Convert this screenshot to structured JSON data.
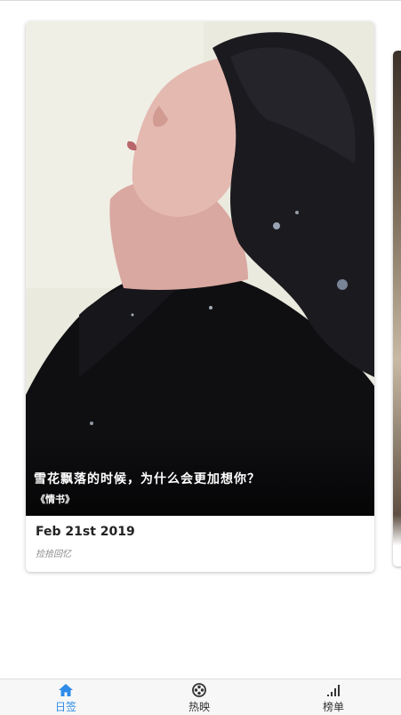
{
  "card": {
    "quote": "雪花飘落的时候，为什么会更加想你？",
    "film": "《情书》",
    "date": "Feb 21st 2019",
    "subtitle": "捡拾回忆"
  },
  "tabbar": {
    "tabs": [
      {
        "label": "日签",
        "icon": "home-icon",
        "active": true
      },
      {
        "label": "热映",
        "icon": "film-reel-icon",
        "active": false
      },
      {
        "label": "榜单",
        "icon": "signal-bars-icon",
        "active": false
      }
    ]
  },
  "colors": {
    "accent": "#2f8ce8",
    "text": "#222222",
    "muted": "#8a8a8a"
  }
}
